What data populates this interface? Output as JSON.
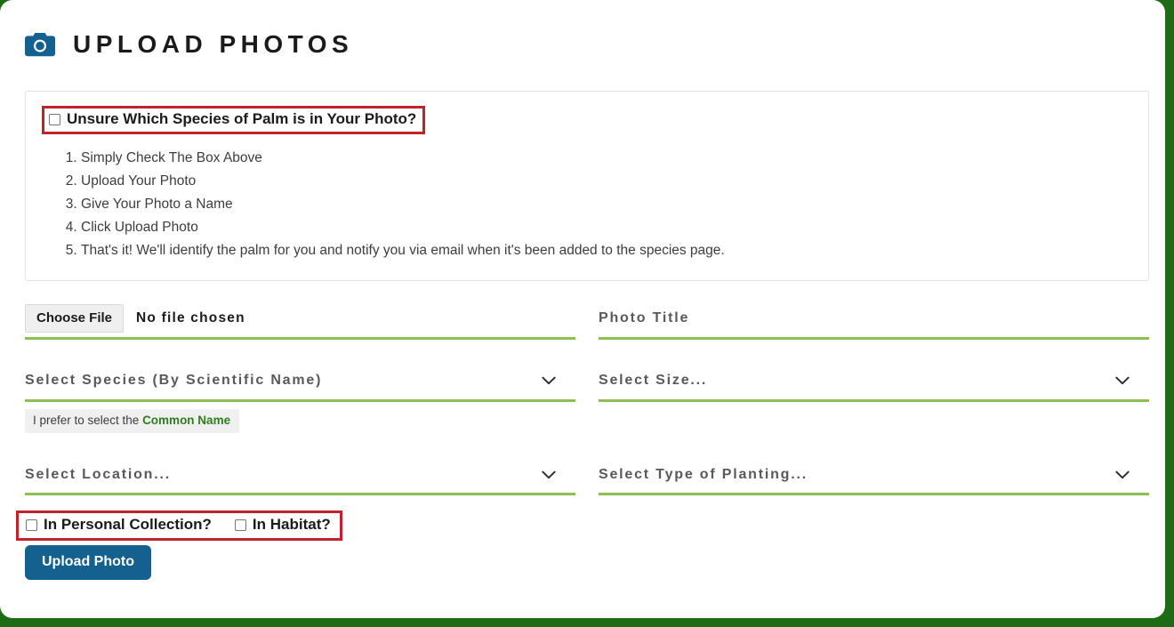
{
  "theme": {
    "page_background": "#1d6b14",
    "card_background": "#ffffff",
    "accent_green": "#8cc152",
    "highlight_red": "#c0232c",
    "button_blue": "#14618f",
    "link_green": "#2e7d1e",
    "icon_blue": "#14618f"
  },
  "header": {
    "icon": "camera-icon",
    "title": "Upload Photos"
  },
  "instructions": {
    "unsure_checkbox": {
      "label": "Unsure Which Species of Palm is in Your Photo?",
      "checked": false,
      "highlighted": true
    },
    "steps": [
      "Simply Check The Box Above",
      "Upload Your Photo",
      "Give Your Photo a Name",
      "Click Upload Photo",
      "That's it! We'll identify the palm for you and notify you via email when it's been added to the species page."
    ]
  },
  "form": {
    "file_input": {
      "button_label": "Choose File",
      "status_text": "No file chosen"
    },
    "photo_title": {
      "placeholder": "Photo Title",
      "value": ""
    },
    "species_select": {
      "placeholder": "Select Species (By Scientific Name)",
      "icon": "chevron-down-icon"
    },
    "size_select": {
      "placeholder": "Select Size...",
      "icon": "chevron-down-icon"
    },
    "location_select": {
      "placeholder": "Select Location...",
      "icon": "chevron-down-icon"
    },
    "planting_type_select": {
      "placeholder": "Select Type of Planting...",
      "icon": "chevron-down-icon"
    },
    "prefer_note": {
      "prefix": "I prefer to select the ",
      "link_label": "Common Name"
    },
    "personal_collection_checkbox": {
      "label": "In Personal Collection?",
      "checked": false
    },
    "habitat_checkbox": {
      "label": "In Habitat?",
      "checked": false
    },
    "highlighted_checkbox_group": true,
    "submit_button": "Upload Photo"
  }
}
